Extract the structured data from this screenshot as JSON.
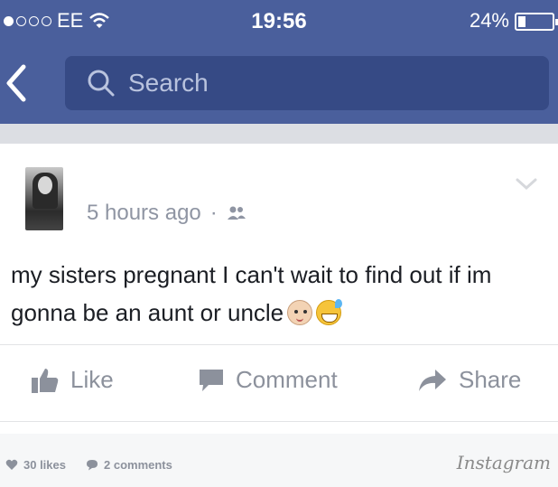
{
  "status_bar": {
    "carrier": "EE",
    "time": "19:56",
    "battery": "24%"
  },
  "nav": {
    "back_icon": "chevron-left-icon",
    "search_placeholder": "Search"
  },
  "post": {
    "timestamp": "5 hours ago",
    "separator": "·",
    "audience_icon": "friends-icon",
    "text": "my sisters pregnant I can't wait to find out if im gonna be an aunt or uncle",
    "emojis": [
      "baby-face-emoji",
      "grinning-sweat-emoji"
    ]
  },
  "actions": {
    "like": "Like",
    "comment": "Comment",
    "share": "Share"
  },
  "footer": {
    "likes": "30 likes",
    "comments": "2 comments",
    "watermark": "Instagram"
  },
  "colors": {
    "header": "#4a5f9c",
    "search_bg": "#364a85",
    "muted": "#8c919c"
  }
}
